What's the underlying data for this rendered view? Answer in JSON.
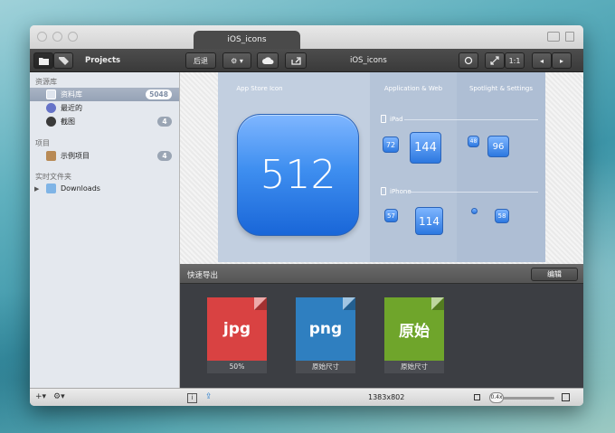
{
  "window": {
    "tab_title": "iOS_icons"
  },
  "toolbar": {
    "projects_label": "Projects",
    "back_label": "后退",
    "doc_title": "iOS_icons",
    "ratio_label": "1:1"
  },
  "sidebar": {
    "library_header": "资源库",
    "items": [
      {
        "label": "资料库",
        "count": "5048"
      },
      {
        "label": "最近的"
      },
      {
        "label": "截图",
        "count": "4"
      }
    ],
    "projects_header": "项目",
    "projects": [
      {
        "label": "示例项目",
        "count": "4"
      }
    ],
    "realtime_header": "实时文件夹",
    "folders": [
      {
        "label": "Downloads"
      }
    ]
  },
  "canvas": {
    "col_appstore": "App Store Icon",
    "col_app": "Application & Web",
    "col_spotlight": "Spotlight & Settings",
    "big_value": "512",
    "ipad_label": "iPad",
    "iphone_label": "iPhone",
    "ipad_icons": [
      "72",
      "144",
      "48",
      "96"
    ],
    "iphone_icons": [
      "57",
      "114",
      "",
      "58"
    ]
  },
  "export": {
    "title": "快速导出",
    "edit_label": "编辑",
    "files": [
      {
        "name": "jpg",
        "caption": "50%",
        "color": "#d94242"
      },
      {
        "name": "png",
        "caption": "原始尺寸",
        "color": "#2f7fc0"
      },
      {
        "name": "原始",
        "caption": "原始尺寸",
        "color": "#6fa52b"
      }
    ]
  },
  "bottom": {
    "add": "+▾",
    "gear": "⚙▾",
    "dimensions": "1383x802",
    "zoom": "0.4x"
  }
}
